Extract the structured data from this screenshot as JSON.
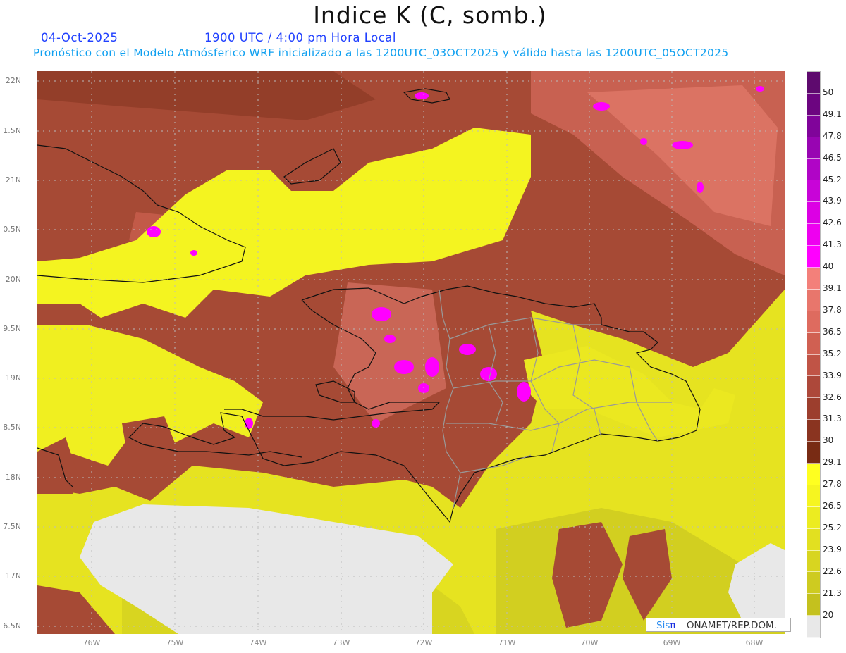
{
  "title": "Indice K (C, somb.)",
  "date": "04-Oct-2025",
  "time": "1900 UTC / 4:00 pm Hora Local",
  "forecast_info": "Pronóstico con el Modelo Atmósferico WRF inicializado a las 1200UTC_03OCT2025 y válido hasta las  1200UTC_05OCT2025",
  "lat_labels": [
    "22N",
    "1.5N",
    "21N",
    "0.5N",
    "20N",
    "9.5N",
    "19N",
    "8.5N",
    "18N",
    "7.5N",
    "17N",
    "6.5N"
  ],
  "lon_labels": [
    "76W",
    "75W",
    "74W",
    "73W",
    "72W",
    "71W",
    "70W",
    "69W",
    "68W"
  ],
  "colorbar": {
    "labels": [
      "50",
      "49.1",
      "47.8",
      "46.5",
      "45.2",
      "43.9",
      "42.6",
      "41.3",
      "40",
      "39.1",
      "37.8",
      "36.5",
      "35.2",
      "33.9",
      "32.6",
      "31.3",
      "30",
      "29.1",
      "27.8",
      "26.5",
      "25.2",
      "23.9",
      "22.6",
      "21.3",
      "20"
    ],
    "colors": [
      "#5e0a6e",
      "#6c0580",
      "#80049a",
      "#9805b2",
      "#b005c6",
      "#c804d8",
      "#dc00e4",
      "#ee00f0",
      "#ff00ff",
      "#f3807a",
      "#e8766c",
      "#de6b5f",
      "#d06052",
      "#c05446",
      "#ad483a",
      "#9c3e2d",
      "#8a3420",
      "#782b14",
      "#ffff20",
      "#f6f520",
      "#ecec20",
      "#e2e020",
      "#d8d520",
      "#cecb20",
      "#c4c11e",
      "#e8e8e8"
    ]
  },
  "credit": {
    "sis": "Sis",
    "pi": "π",
    "org": " –  ONAMET/REP.DOM."
  }
}
